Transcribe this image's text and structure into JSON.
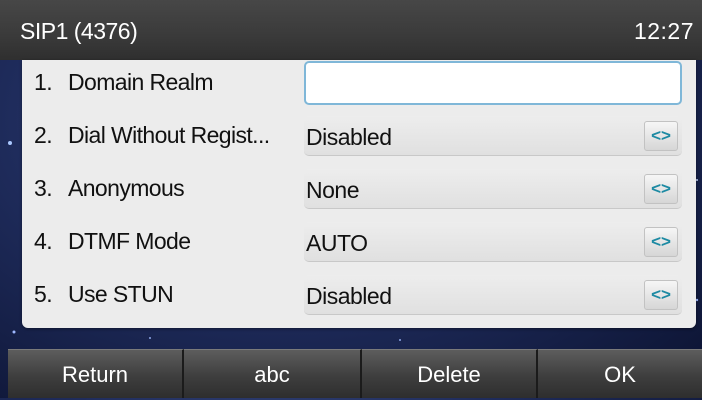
{
  "header": {
    "title": "SIP1 (4376)",
    "time": "12:27"
  },
  "rows": [
    {
      "number": "1.",
      "label": "Domain Realm",
      "value": ""
    },
    {
      "number": "2.",
      "label": "Dial Without Regist...",
      "value": "Disabled",
      "arrows": "<>"
    },
    {
      "number": "3.",
      "label": "Anonymous",
      "value": "None",
      "arrows": "<>"
    },
    {
      "number": "4.",
      "label": "DTMF Mode",
      "value": "AUTO",
      "arrows": "<>"
    },
    {
      "number": "5.",
      "label": "Use STUN",
      "value": "Disabled",
      "arrows": "<>"
    }
  ],
  "softkeys": [
    "Return",
    "abc",
    "Delete",
    "OK"
  ],
  "colors": {
    "header_bg": "#3a3a3a",
    "panel_bg": "#ececec",
    "input_border": "#7fb7d8",
    "arrow_color": "#1d8aa3",
    "background": "#1f2c5c"
  },
  "icons": {
    "selector": "left-right-arrows-icon"
  }
}
